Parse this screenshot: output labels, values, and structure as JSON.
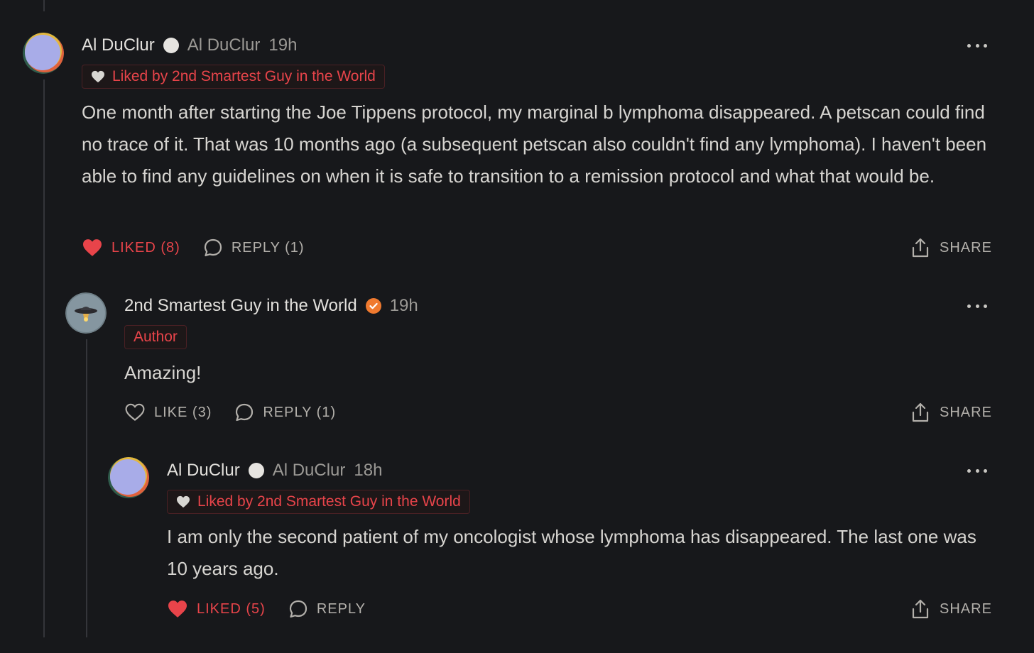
{
  "colors": {
    "background": "#17181b",
    "accent_red": "#e8444a",
    "verified_orange": "#f07a2f"
  },
  "comments": [
    {
      "author": "Al DuClur",
      "handle": "Al DuClur",
      "time": "19h",
      "badge_icon": "circle-badge-icon",
      "liked_by": "Liked by 2nd Smartest Guy in the World",
      "text": "One month after starting the Joe Tippens protocol, my marginal b lymphoma disappeared. A petscan could find no trace of it. That was 10 months ago (a subsequent petscan also couldn't find any lymphoma). I haven't been able to find any guidelines on when it is safe to transition to a remission protocol and what that would be.",
      "like_label": "LIKED (8)",
      "liked": true,
      "reply_label": "REPLY (1)",
      "share_label": "SHARE"
    },
    {
      "author": "2nd Smartest Guy in the World",
      "time": "19h",
      "badge_icon": "verified-check-icon",
      "tag": "Author",
      "text": "Amazing!",
      "like_label": "LIKE (3)",
      "liked": false,
      "reply_label": "REPLY (1)",
      "share_label": "SHARE"
    },
    {
      "author": "Al DuClur",
      "handle": "Al DuClur",
      "time": "18h",
      "badge_icon": "circle-badge-icon",
      "liked_by": "Liked by 2nd Smartest Guy in the World",
      "text": "I am only the second patient of my oncologist whose lymphoma has disappeared. The last one was 10 years ago.",
      "like_label": "LIKED (5)",
      "liked": true,
      "reply_label": "REPLY",
      "share_label": "SHARE"
    }
  ]
}
